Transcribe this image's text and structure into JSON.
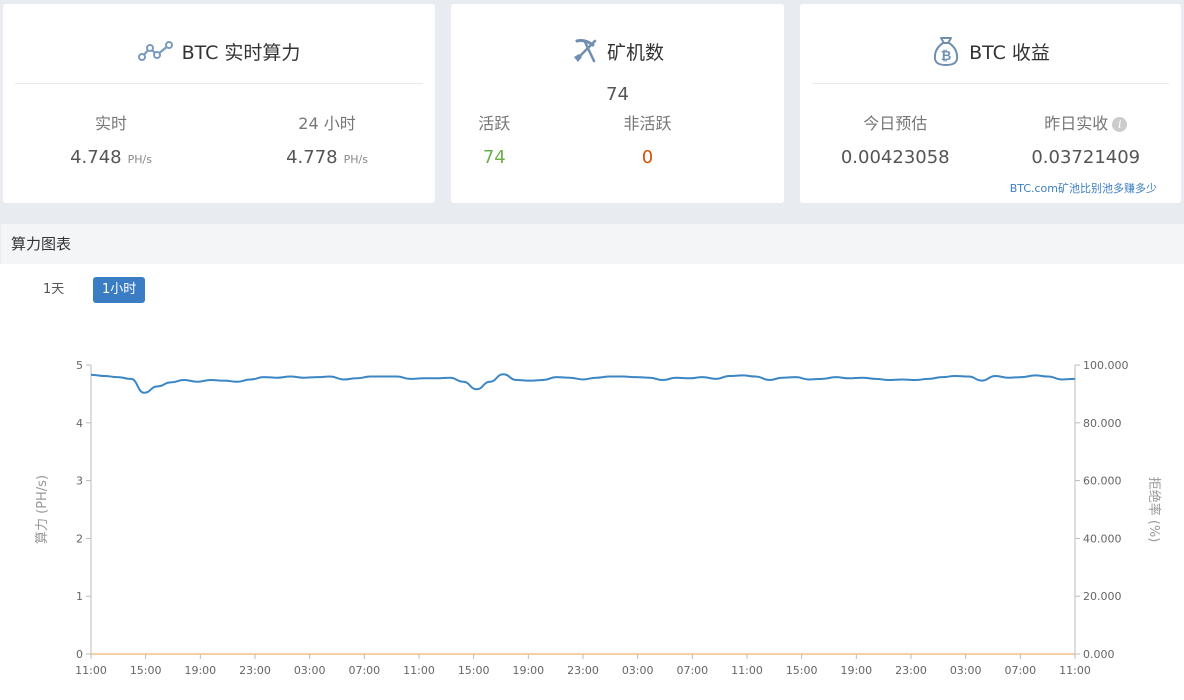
{
  "hashrate_card": {
    "title": "BTC 实时算力",
    "realtime_label": "实时",
    "realtime_value": "4.748",
    "realtime_unit": "PH/s",
    "day_label": "24 小时",
    "day_value": "4.778",
    "day_unit": "PH/s"
  },
  "workers_card": {
    "title": "矿机数",
    "total": "74",
    "active_label": "活跃",
    "active_value": "74",
    "inactive_label": "非活跃",
    "inactive_value": "0"
  },
  "earnings_card": {
    "title": "BTC 收益",
    "today_label": "今日预估",
    "today_value": "0.00423058",
    "yesterday_label": "昨日实收",
    "yesterday_value": "0.03721409",
    "info_glyph": "i",
    "compare_link": "BTC.com矿池比别池多赚多少"
  },
  "chart_section": {
    "title": "算力图表",
    "range_1d": "1天",
    "range_1h": "1小时"
  },
  "colors": {
    "accent": "#3b7dc4",
    "active_green": "#6ab04c",
    "inactive_red": "#d35400",
    "hashrate_line": "#3b86c4",
    "reject_line": "#f0c08a"
  },
  "chart_data": {
    "type": "line",
    "x": [
      "11:00",
      "15:00",
      "19:00",
      "23:00",
      "03:00",
      "07:00",
      "11:00",
      "15:00",
      "19:00",
      "23:00",
      "03:00",
      "07:00",
      "11:00",
      "15:00",
      "19:00",
      "23:00",
      "03:00",
      "07:00",
      "11:00"
    ],
    "ylabel": "算力 (PH/s)",
    "ylabel_right": "拒绝率 (%)",
    "ylim": [
      0,
      5
    ],
    "yticks": [
      "0",
      "1",
      "2",
      "3",
      "4",
      "5"
    ],
    "ylim_right": [
      0,
      100
    ],
    "yticks_right": [
      "0.000",
      "20.000",
      "40.000",
      "60.000",
      "80.000",
      "100.000"
    ],
    "grid": false,
    "series": [
      {
        "axis": "left",
        "values": [
          4.83,
          4.81,
          4.79,
          4.76,
          4.52,
          4.63,
          4.7,
          4.74,
          4.71,
          4.74,
          4.73,
          4.71,
          4.75,
          4.79,
          4.78,
          4.8,
          4.78,
          4.79,
          4.8,
          4.75,
          4.77,
          4.8,
          4.8,
          4.8,
          4.76,
          4.77,
          4.77,
          4.78,
          4.71,
          4.58,
          4.71,
          4.84,
          4.74,
          4.73,
          4.74,
          4.79,
          4.78,
          4.75,
          4.78,
          4.8,
          4.8,
          4.79,
          4.78,
          4.74,
          4.78,
          4.77,
          4.79,
          4.76,
          4.81,
          4.82,
          4.8,
          4.74,
          4.78,
          4.79,
          4.75,
          4.76,
          4.79,
          4.77,
          4.78,
          4.76,
          4.74,
          4.75,
          4.74,
          4.76,
          4.79,
          4.81,
          4.8,
          4.73,
          4.81,
          4.78,
          4.79,
          4.82,
          4.8,
          4.75,
          4.76
        ]
      },
      {
        "axis": "right",
        "values": [
          0,
          0,
          0,
          0,
          0,
          0,
          0,
          0,
          0,
          0,
          0,
          0,
          0,
          0,
          0,
          0,
          0,
          0,
          0,
          0,
          0,
          0,
          0,
          0,
          0,
          0,
          0,
          0,
          0,
          0,
          0,
          0,
          0,
          0,
          0,
          0,
          0,
          0,
          0,
          0,
          0,
          0,
          0,
          0,
          0,
          0,
          0,
          0,
          0,
          0,
          0,
          0,
          0,
          0,
          0,
          0,
          0,
          0,
          0,
          0,
          0,
          0,
          0,
          0,
          0,
          0,
          0,
          0,
          0,
          0,
          0,
          0,
          0,
          0,
          0
        ]
      }
    ]
  }
}
